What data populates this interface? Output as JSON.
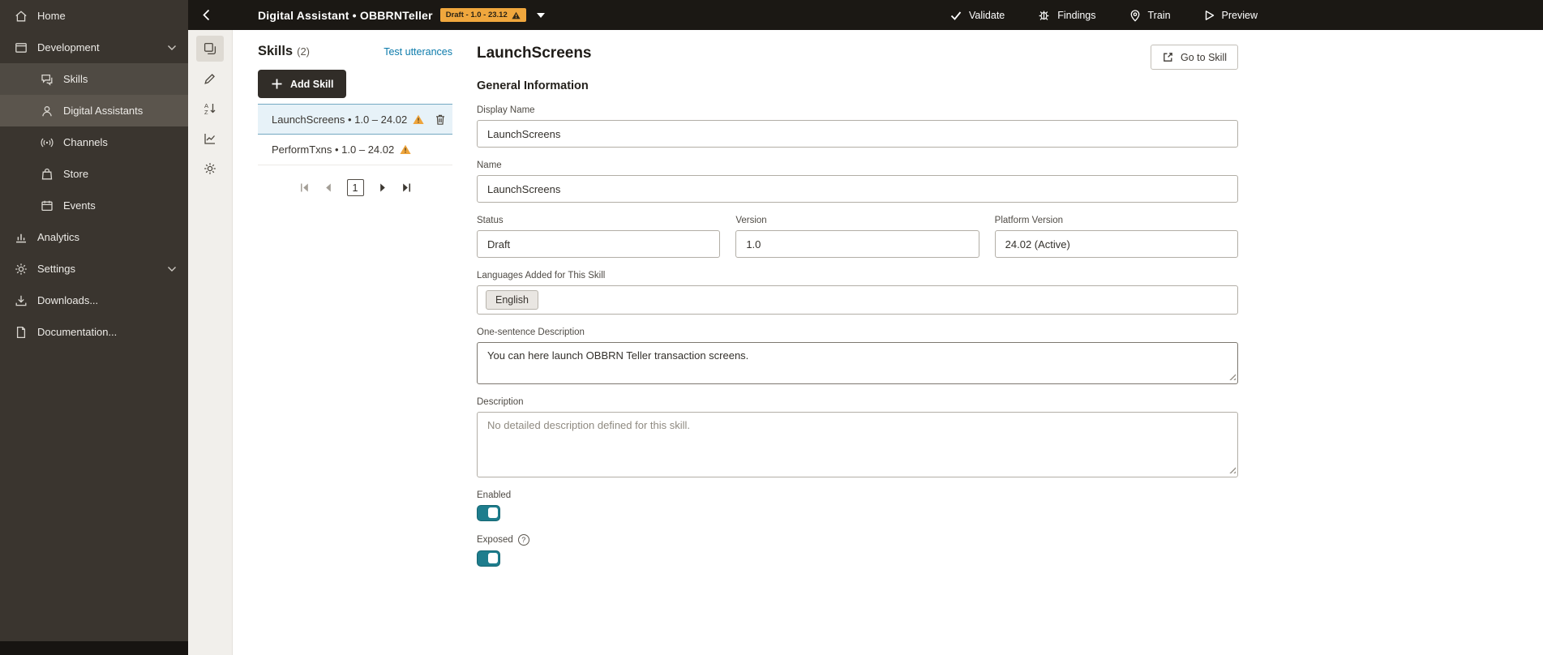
{
  "topbar": {
    "title": "Digital Assistant • OBBRNTeller",
    "badge_label": "Draft - 1.0 - 23.12",
    "validate_label": "Validate",
    "findings_label": "Findings",
    "train_label": "Train",
    "preview_label": "Preview"
  },
  "sidebar": {
    "home_label": "Home",
    "development_label": "Development",
    "skills_label": "Skills",
    "digital_assistants_label": "Digital Assistants",
    "channels_label": "Channels",
    "store_label": "Store",
    "events_label": "Events",
    "analytics_label": "Analytics",
    "settings_label": "Settings",
    "downloads_label": "Downloads...",
    "documentation_label": "Documentation..."
  },
  "skills_panel": {
    "title": "Skills",
    "count": "(2)",
    "test_utterances_label": "Test utterances",
    "add_skill_label": "Add Skill",
    "items": [
      {
        "label": "LaunchScreens • 1.0 – 24.02",
        "selected": true,
        "warning": true
      },
      {
        "label": "PerformTxns • 1.0 – 24.02",
        "selected": false,
        "warning": true
      }
    ],
    "page_number": "1"
  },
  "main": {
    "title": "LaunchScreens",
    "go_to_skill_label": "Go to Skill",
    "section_title": "General Information",
    "display_name": {
      "label": "Display Name",
      "value": "LaunchScreens"
    },
    "name": {
      "label": "Name",
      "value": "LaunchScreens"
    },
    "status": {
      "label": "Status",
      "value": "Draft"
    },
    "version": {
      "label": "Version",
      "value": "1.0"
    },
    "platform_version": {
      "label": "Platform Version",
      "value": "24.02 (Active)"
    },
    "languages": {
      "label": "Languages Added for This Skill",
      "chip": "English"
    },
    "one_sentence_description": {
      "label": "One-sentence Description",
      "value": "You can here launch OBBRN Teller transaction screens."
    },
    "description": {
      "label": "Description",
      "placeholder": "No detailed description defined for this skill."
    },
    "enabled": {
      "label": "Enabled",
      "state": "on"
    },
    "exposed": {
      "label": "Exposed",
      "state": "on",
      "help": "?"
    }
  },
  "colors": {
    "accent_teal": "#1e7d8d",
    "link_blue": "#0c7bab",
    "warning_amber": "#f0a73d",
    "sidebar_bg": "#3a352f",
    "topbar_bg": "#1b1814",
    "selected_item_bg": "#e7f2f8"
  },
  "icons": {
    "back": "chevron-left",
    "badge_warning": "triangle-exclamation",
    "version_dropdown": "caret-down",
    "validate": "checkmark",
    "findings": "bug",
    "train": "map-pin",
    "preview": "play-outline",
    "skill_warning": "triangle-exclamation",
    "delete": "trash-can",
    "go_to_skill": "external-link",
    "exposed_help": "question-circle"
  }
}
